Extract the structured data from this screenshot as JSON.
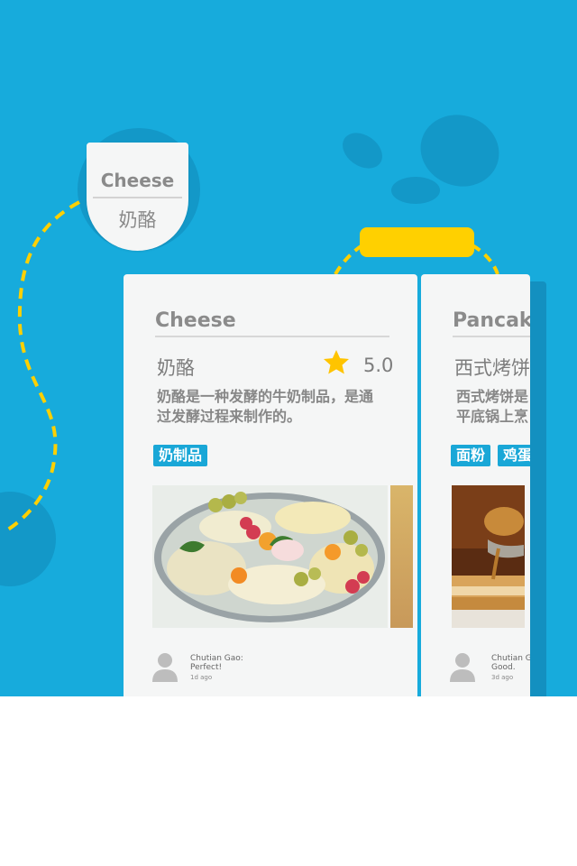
{
  "tag": {
    "en": "Cheese",
    "zh": "奶酪"
  },
  "cards": [
    {
      "title_en": "Cheese",
      "title_zh": "奶酪",
      "rating": "5.0",
      "desc_lines": [
        "奶酪是一种发酵的牛奶制品，是通",
        "过发酵过程来制作的。"
      ],
      "chips": [
        "奶制品"
      ],
      "comment": {
        "user": "Chutian Gao:",
        "text": "Perfect!",
        "time": "1d ago"
      }
    },
    {
      "title_en": "Pancake",
      "title_zh": "西式烤饼",
      "desc_lines": [
        "西式烤饼是",
        "平底锅上烹"
      ],
      "chips": [
        "面粉",
        "鸡蛋"
      ],
      "comment": {
        "user": "Chutian G",
        "text": "Good.",
        "time": "3d ago"
      }
    }
  ],
  "colors": {
    "background": "#17abdc",
    "accent": "#ffd000",
    "card": "#f5f6f6",
    "chip": "#19a7d7"
  },
  "icons": {
    "rating": "star-icon",
    "avatar": "user-avatar-icon"
  }
}
